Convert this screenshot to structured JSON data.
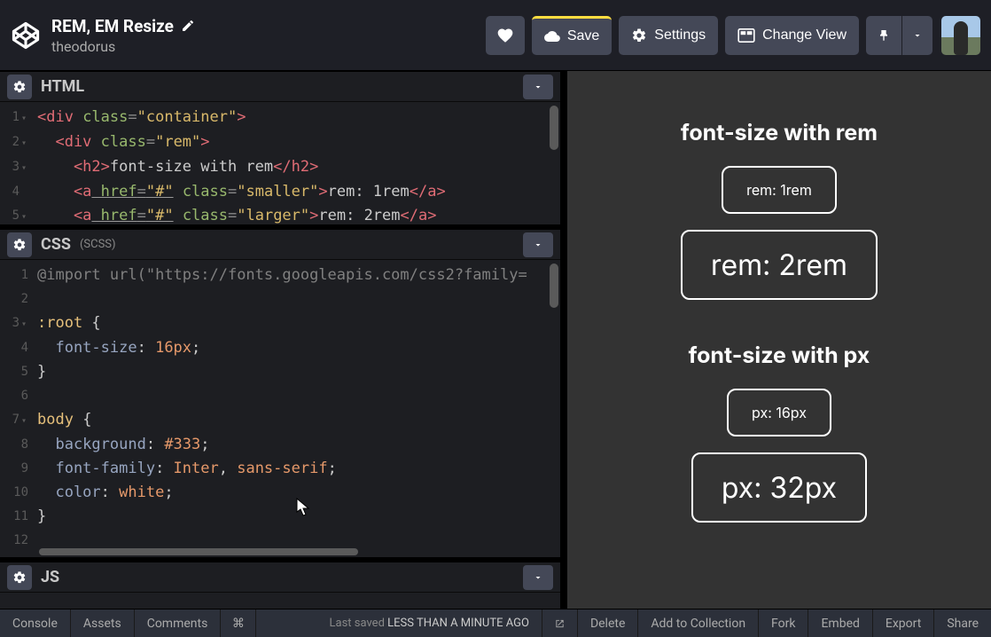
{
  "header": {
    "title": "REM, EM Resize",
    "author": "theodorus",
    "buttons": {
      "save": "Save",
      "settings": "Settings",
      "changeView": "Change View"
    }
  },
  "panes": {
    "html": {
      "title": "HTML"
    },
    "css": {
      "title": "CSS",
      "sub": "(SCSS)"
    },
    "js": {
      "title": "JS"
    }
  },
  "htmlCode": {
    "l1_a": "<div",
    "l1_b": " class",
    "l1_c": "=",
    "l1_d": "\"container\"",
    "l1_e": ">",
    "l2_a": "  <div",
    "l2_b": " class",
    "l2_c": "=",
    "l2_d": "\"rem\"",
    "l2_e": ">",
    "l3_a": "    <h2>",
    "l3_b": "font-size with rem",
    "l3_c": "</h2>",
    "l4_a": "    <a",
    "l4_b": " href",
    "l4_c": "=",
    "l4_d": "\"#\"",
    "l4_e": " class",
    "l4_f": "=",
    "l4_g": "\"smaller\"",
    "l4_h": ">",
    "l4_i": "rem: 1rem",
    "l4_j": "</a>",
    "l5_a": "    <a",
    "l5_b": " href",
    "l5_c": "=",
    "l5_d": "\"#\"",
    "l5_e": " class",
    "l5_f": "=",
    "l5_g": "\"larger\"",
    "l5_h": ">",
    "l5_i": "rem: 2rem",
    "l5_j": "</a>"
  },
  "cssCode": {
    "l1_a": "@import",
    "l1_b": " url(",
    "l1_c": "\"https://fonts.googleapis.com/css2?family=",
    "l3_a": ":root",
    "l3_b": " {",
    "l4_a": "  font-size",
    "l4_b": ": ",
    "l4_c": "16px",
    "l4_d": ";",
    "l5_a": "}",
    "l7_a": "body",
    "l7_b": " {",
    "l8_a": "  background",
    "l8_b": ": ",
    "l8_c": "#333",
    "l8_d": ";",
    "l9_a": "  font-family",
    "l9_b": ": ",
    "l9_c": "Inter",
    "l9_d": ", ",
    "l9_e": "sans-serif",
    "l9_f": ";",
    "l10_a": "  color",
    "l10_b": ": ",
    "l10_c": "white",
    "l10_d": ";",
    "l11_a": "}"
  },
  "preview": {
    "h1": "font-size with rem",
    "b1": "rem: 1rem",
    "b2": "rem: 2rem",
    "h2": "font-size with px",
    "b3": "px: 16px",
    "b4": "px: 32px"
  },
  "footer": {
    "console": "Console",
    "assets": "Assets",
    "comments": "Comments",
    "cmd": "⌘",
    "lastSavedLabel": "Last saved",
    "lastSavedAgo": "LESS THAN A MINUTE AGO",
    "delete": "Delete",
    "addToCollection": "Add to Collection",
    "fork": "Fork",
    "embed": "Embed",
    "export": "Export",
    "share": "Share"
  },
  "lineNums": {
    "h1": "1",
    "h2": "2",
    "h3": "3",
    "h4": "4",
    "h5": "5",
    "c1": "1",
    "c2": "2",
    "c3": "3",
    "c4": "4",
    "c5": "5",
    "c6": "6",
    "c7": "7",
    "c8": "8",
    "c9": "9",
    "c10": "10",
    "c11": "11",
    "c12": "12"
  }
}
